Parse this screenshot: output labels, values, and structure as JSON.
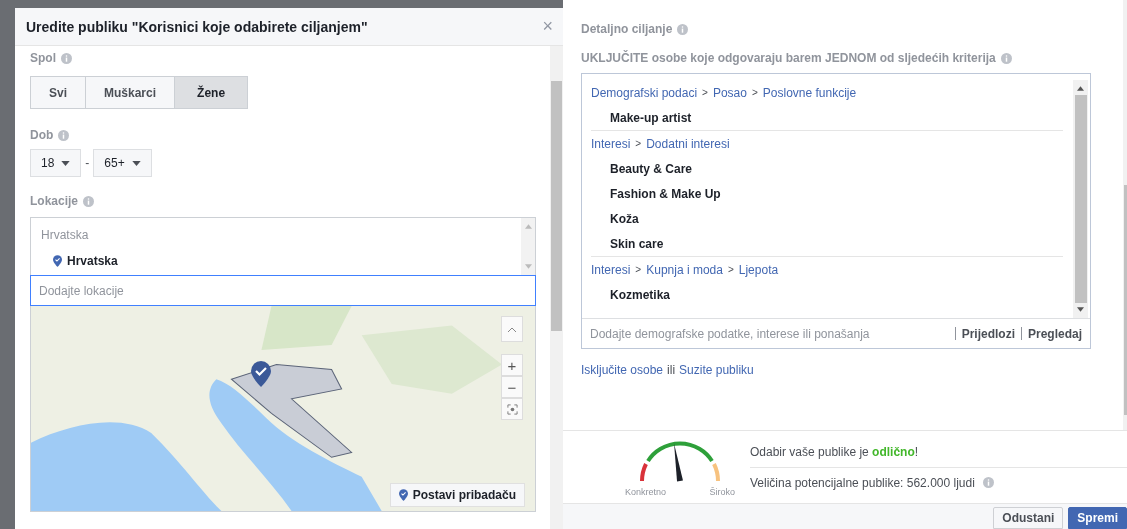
{
  "edit_dialog": {
    "title": "Uredite publiku \"Korisnici koje odabirete ciljanjem\"",
    "close": "×",
    "gender": {
      "label": "Spol",
      "options": [
        {
          "label": "Svi",
          "selected": false
        },
        {
          "label": "Muškarci",
          "selected": false
        },
        {
          "label": "Žene",
          "selected": true
        }
      ]
    },
    "age": {
      "label": "Dob",
      "from": "18",
      "separator": "-",
      "to": "65+"
    },
    "locations": {
      "label": "Lokacije",
      "group": "Hrvatska",
      "items": [
        {
          "name": "Hrvatska"
        }
      ],
      "placeholder": "Dodajte lokacije",
      "map": {
        "zoom_in": "+",
        "zoom_out": "−",
        "pin_button": "Postavi pribadaču"
      }
    }
  },
  "detailed_targeting": {
    "label": "Detaljno ciljanje",
    "include_label": "UKLJUČITE osobe koje odgovaraju barem JEDNOM od sljedećih kriterija",
    "separator": ">",
    "groups": [
      {
        "path": [
          "Demografski podaci",
          "Posao",
          "Poslovne funkcije"
        ],
        "items": [
          "Make-up artist"
        ]
      },
      {
        "path": [
          "Interesi",
          "Dodatni interesi"
        ],
        "items": [
          "Beauty & Care",
          "Fashion & Make Up",
          "Koža",
          "Skin care"
        ]
      },
      {
        "path": [
          "Interesi",
          "Kupnja i moda",
          "Ljepota"
        ],
        "items": [
          "Kozmetika"
        ]
      }
    ],
    "placeholder": "Dodajte demografske podatke, interese ili ponašanja",
    "actions": [
      "Prijedlozi",
      "Pregledaj"
    ],
    "footer": {
      "exclude_link": "Isključite osobe",
      "joiner": "ili",
      "narrow_link": "Suzite publiku"
    }
  },
  "audience": {
    "gauge": {
      "level": 0.45,
      "left_label": "Konkretno",
      "right_label": "Široko"
    },
    "message": {
      "before": "Odabir vaše publike je ",
      "highlight": "odlično",
      "after": "!"
    },
    "size": "Veličina potencijalne publike: 562.000 ljudi"
  },
  "buttons": [
    {
      "label": "Odustani",
      "kind": "secondary"
    },
    {
      "label": "Spremi",
      "kind": "primary"
    }
  ]
}
